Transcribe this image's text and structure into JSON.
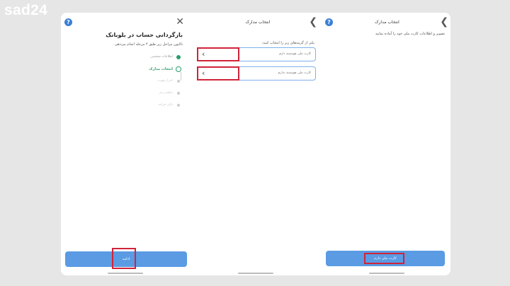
{
  "watermark": "sad24",
  "panel1": {
    "title": "بازگردانی حساب در بلوبانک",
    "subtitle": "تاکنون مراحل زیر طبق ۴ مرحله انجام می‌دهی",
    "steps": [
      {
        "label": "اطلاعات شخصی",
        "state": "done"
      },
      {
        "label": "انتخاب مدارک",
        "state": "active"
      },
      {
        "label": "احراز هویت",
        "state": "pending"
      },
      {
        "label": "تنظیم رمز",
        "state": "pending"
      },
      {
        "label": "پایان فرایند",
        "state": "pending"
      }
    ],
    "button_label": "ادامه"
  },
  "panel2": {
    "title": "انتخاب مدارک",
    "question": "یکی از گزینه‌های زیر را انتخاب کنید:",
    "options": [
      "کارت ملی هوشمند دارم",
      "کارت ملی هوشمند ندارم"
    ]
  },
  "panel3": {
    "title": "انتخاب مدارک",
    "text": "تصویر و اطلاعات کارت ملی خود را آماده نمایید",
    "button_label": "کارت ملی دارم"
  },
  "colors": {
    "accent": "#5a9be3",
    "success": "#2a9d6a",
    "highlight": "#d0233a"
  }
}
